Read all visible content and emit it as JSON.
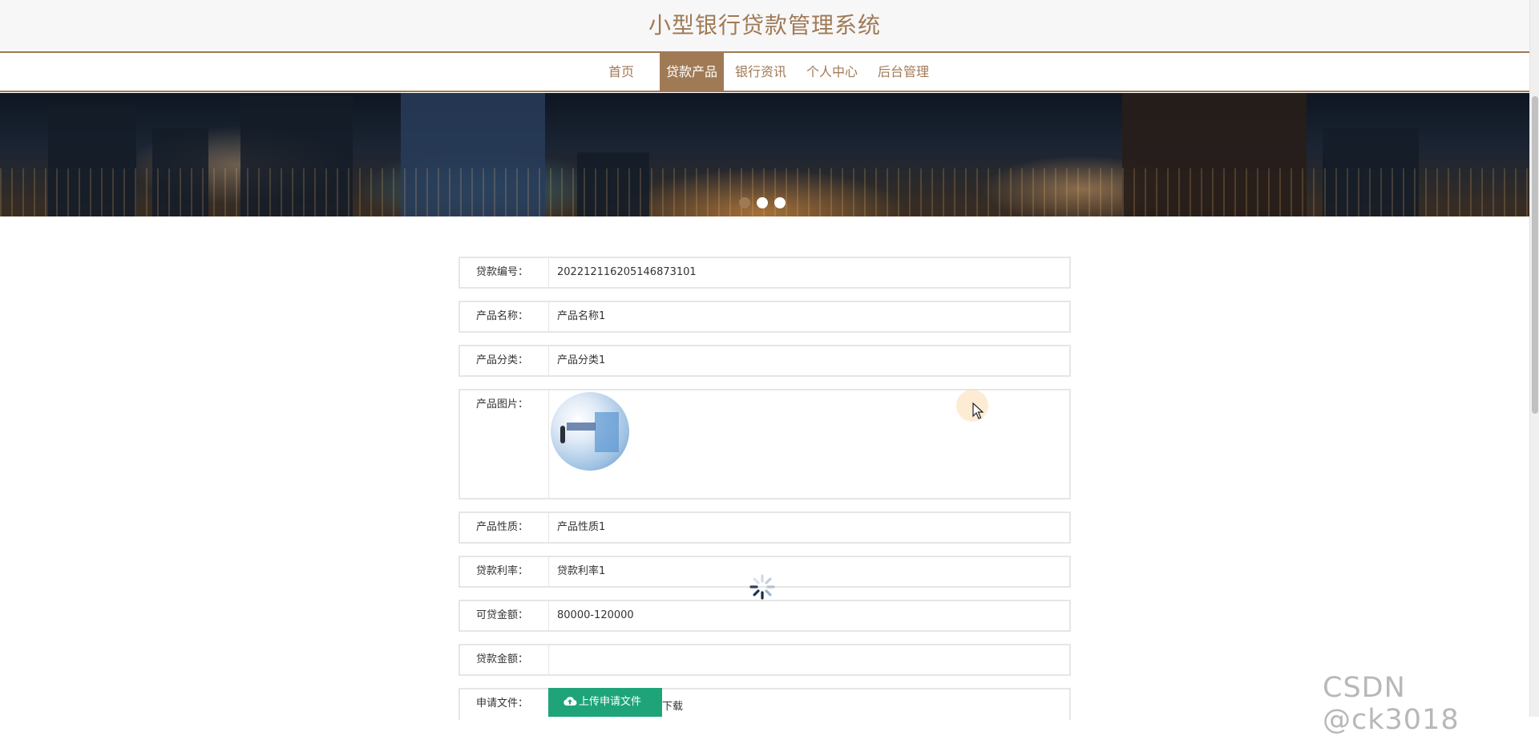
{
  "header": {
    "title": "小型银行贷款管理系统"
  },
  "nav": {
    "items": [
      {
        "label": "首页",
        "active": false
      },
      {
        "label": "贷款产品",
        "active": true
      },
      {
        "label": "银行资讯",
        "active": false
      },
      {
        "label": "个人中心",
        "active": false
      },
      {
        "label": "后台管理",
        "active": false
      }
    ]
  },
  "banner": {
    "slide_count": 3,
    "active_slide": 1
  },
  "form": {
    "fields": [
      {
        "label": "贷款编号：",
        "value": "202212116205146873101"
      },
      {
        "label": "产品名称：",
        "value": "产品名称1"
      },
      {
        "label": "产品分类：",
        "value": "产品分类1"
      },
      {
        "label": "产品图片：",
        "value": ""
      },
      {
        "label": "产品性质：",
        "value": "产品性质1"
      },
      {
        "label": "贷款利率：",
        "value": "贷款利率1"
      },
      {
        "label": "可贷金额：",
        "value": "80000-120000"
      },
      {
        "label": "贷款金额：",
        "value": ""
      },
      {
        "label": "申请文件：",
        "upload_label": "上传申请文件",
        "download_label": "下载"
      }
    ]
  },
  "watermark": "CSDN @ck3018",
  "colors": {
    "accent": "#a07a55",
    "upload_button": "#1fa479",
    "border": "#e6e6e6"
  }
}
